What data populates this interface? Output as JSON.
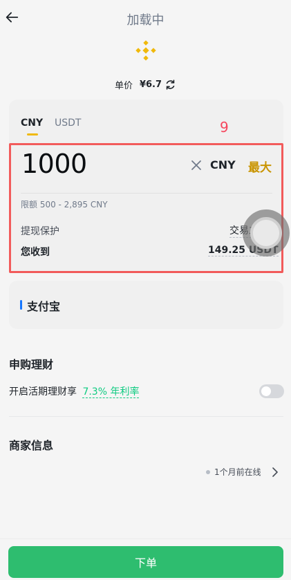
{
  "header": {
    "title": "加载中",
    "back_icon": "arrow-left-icon",
    "logo_icon": "binance-logo-icon"
  },
  "price": {
    "label": "单价",
    "value": "¥6.7"
  },
  "tabs": [
    {
      "label": "CNY",
      "active": true
    },
    {
      "label": "USDT",
      "active": false
    }
  ],
  "overlay_marker": "9",
  "amount": {
    "value": "1000",
    "currency": "CNY",
    "max_label": "最大",
    "limit_text": "限额 500 - 2,895 CNY"
  },
  "details": {
    "protection_label": "提现保护",
    "protection_value": "交易之星",
    "receive_label": "您收到",
    "receive_value": "149.25 USDT"
  },
  "payment": {
    "method": "支付宝"
  },
  "finance": {
    "title": "申购理财",
    "row_text": "开启活期理财享",
    "rate_text": "7.3% 年利率",
    "enabled": false
  },
  "merchant": {
    "title": "商家信息",
    "online_text": "1个月前在线"
  },
  "order_button": "下单",
  "colors": {
    "accent": "#f0b90b",
    "buy_green": "#2ebd6f",
    "rate_green": "#0ecb81",
    "marker_red": "#f25b5b"
  }
}
